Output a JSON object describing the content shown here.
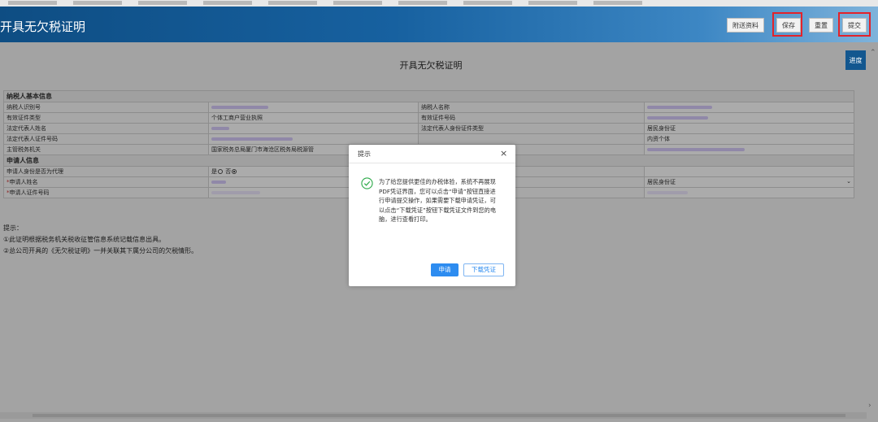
{
  "header": {
    "title": "开具无欠税证明",
    "buttons": {
      "attach": "附送资料",
      "save": "保存",
      "reset": "重置",
      "submit": "提交"
    }
  },
  "page": {
    "heading": "开具无欠税证明",
    "progress_button": "进度"
  },
  "sections": {
    "taxpayer": "纳税人基本信息",
    "applicant": "申请人信息"
  },
  "taxpayer_rows": [
    {
      "l1": "纳税人识别号",
      "v1": "",
      "l2": "纳税人名称",
      "v2": ""
    },
    {
      "l1": "有效证件类型",
      "v1": "个体工商户营业执照",
      "l2": "有效证件号码",
      "v2": ""
    },
    {
      "l1": "法定代表人姓名",
      "v1": "",
      "l2": "法定代表人身份证件类型",
      "v2": "居民身份证"
    },
    {
      "l1": "法定代表人证件号码",
      "v1": "",
      "l2": "",
      "v2": "内资个体"
    },
    {
      "l1": "主管税务机关",
      "v1": "国家税务总局厦门市海沧区税务局税源管",
      "l2": "",
      "v2": ""
    }
  ],
  "applicant_rows": {
    "agent_label": "申请人身份是否为代理",
    "agent_yes": "是",
    "agent_no": "否",
    "name_label": "申请人姓名",
    "id_label": "申请人证件号码",
    "id_type_value": "居民身份证"
  },
  "tips": {
    "title": "提示：",
    "line1": "①此证明根据税务机关税收征管信息系统记载信息出具。",
    "line2": "②总公司开具的《无欠税证明》一并关联其下属分公司的欠税情形。"
  },
  "modal": {
    "title": "提示",
    "message": "为了给您提供更佳的办税体验，系统不再展现PDF凭证界面，您可以点击“申请”按钮直接进行申请提交操作，如果需要下载申请凭证，可以点击“下载凭证”按钮下载凭证文件到您的电脑，进行查看打印。",
    "apply_button": "申请",
    "download_button": "下载凭证"
  },
  "colors": {
    "header_blue": "#1761a0",
    "highlight_red": "#e3222a",
    "primary_blue": "#2d8cf0",
    "success_green": "#2eaa4a"
  }
}
